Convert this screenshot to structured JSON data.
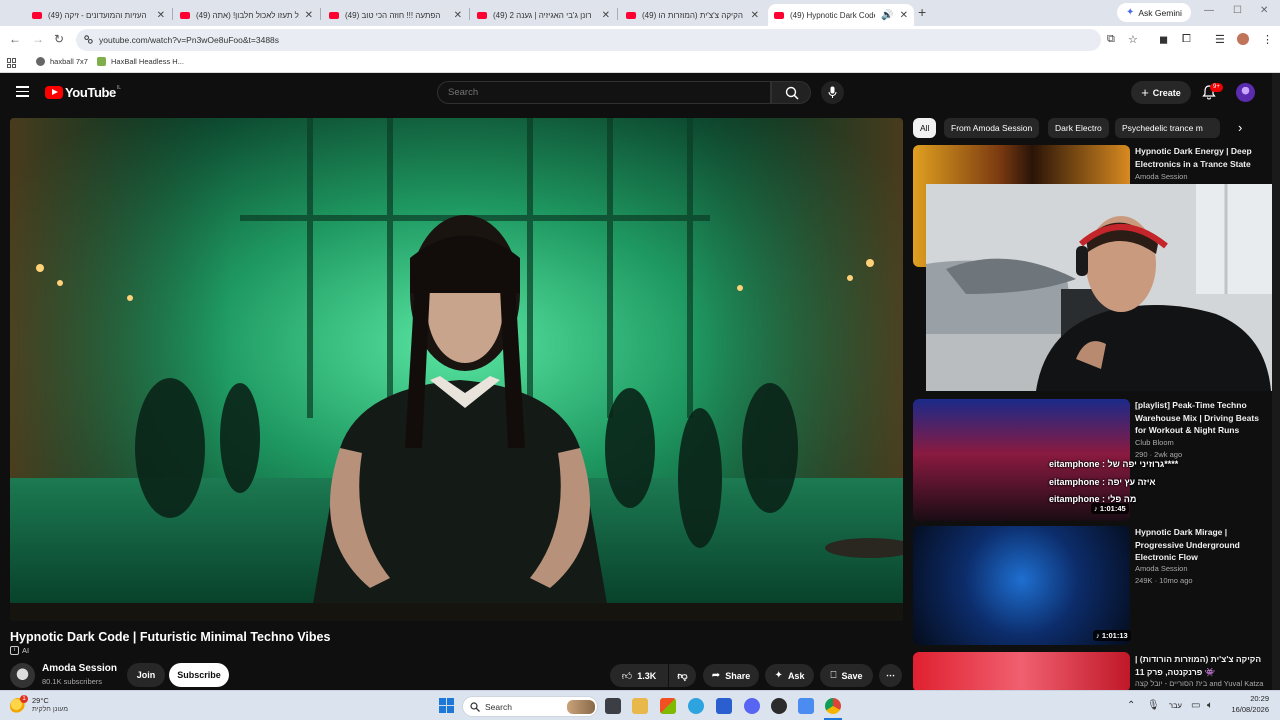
{
  "browser": {
    "tabs": [
      {
        "title": "העזיות והמועדונים - זיקה (49)",
        "active": false
      },
      {
        "title": "(49) אל תעזו לאכול חלבון! (אתה",
        "active": false
      },
      {
        "title": "הפתעה !!! חוזה הכי טוב (49)",
        "active": false
      },
      {
        "title": "(49) רונן ג'בי האגיזיה | גענה 2",
        "active": false
      },
      {
        "title": "(49) הקיקה צ'צ'ית (המוזרות הו",
        "active": false
      },
      {
        "title": "(49) Hypnotic Dark Code | F",
        "active": true
      }
    ],
    "ask_gemini": "Ask Gemini",
    "url": "youtube.com/watch?v=Pn3wOe8uFoo&t=3488s",
    "bookmarks": [
      "haxball 7x7",
      "HaxBall Headless H..."
    ]
  },
  "youtube": {
    "logo_text": "YouTube",
    "logo_country": "IL",
    "search_placeholder": "Search",
    "create_label": "Create",
    "notifications_badge": "9+",
    "chips": [
      "All",
      "From Amoda Session",
      "Dark Electro",
      "Psychedelic trance m"
    ],
    "video": {
      "title": "Hypnotic Dark Code | Futuristic Minimal Techno Vibes",
      "ai_label": "AI",
      "channel": "Amoda Session",
      "subscribers": "80.1K subscribers",
      "join_label": "Join",
      "subscribe_label": "Subscribe",
      "likes": "1.3K",
      "share_label": "Share",
      "ask_label": "Ask",
      "save_label": "Save"
    },
    "recommendations": [
      {
        "title": "Hypnotic Dark Energy | Deep Electronics in a Trance State",
        "channel": "Amoda Session",
        "meta": "",
        "duration": ""
      },
      {
        "title": "[playlist] Peak-Time Techno Warehouse Mix | Driving Beats for Workout & Night Runs",
        "channel": "Club Bloom",
        "meta": "290 · 2wk ago",
        "duration": "1:01:45"
      },
      {
        "title": "Hypnotic Dark Mirage | Progressive Underground Electronic Flow",
        "channel": "Amoda Session",
        "meta": "249K · 10mo ago",
        "duration": "1:01:13"
      },
      {
        "title": "הקיקה צ'צ'ית (המוזרות הורודות) | פרנקנטה, פרק 11 👾",
        "channel": "בית הסוריים - יובל קצה and Yuval Katza",
        "meta": "",
        "duration": ""
      }
    ],
    "chat_overlay": [
      "eitamphone : גרוזיני יפה של****",
      "eitamphone : איזה עץ יפה",
      "eitamphone : מה פלי"
    ]
  },
  "taskbar": {
    "weather_temp": "29°C",
    "weather_desc": "מעונן חלקית",
    "weather_alert": "1",
    "search_label": "Search",
    "lang": "עבר",
    "time": "20:29",
    "date": "16/08/2026"
  }
}
